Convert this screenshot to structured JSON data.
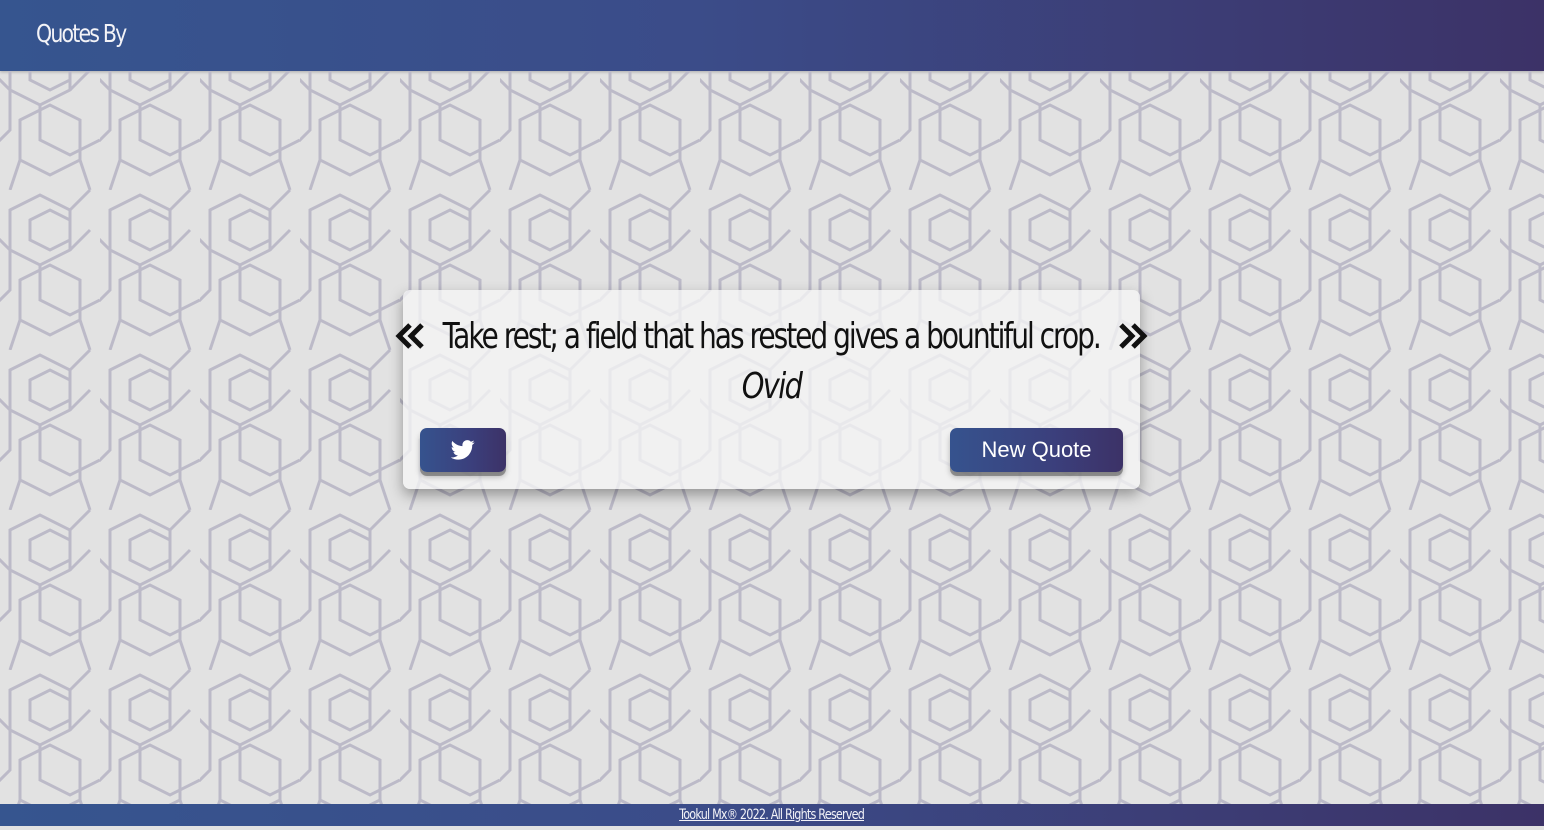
{
  "header": {
    "brand": "Quotes By"
  },
  "quote": {
    "text": "Take rest; a field that has rested gives a bountiful crop.",
    "author": "Ovid"
  },
  "buttons": {
    "tweet_icon": "twitter-icon",
    "new_quote_label": "New Quote"
  },
  "footer": {
    "text": "Tookul Mx® 2022. All Rights Reserved"
  },
  "colors": {
    "brand_start": "#36558f",
    "brand_end": "#3c3267",
    "background": "#e2e2e2",
    "pattern": "#b9b7c6"
  }
}
